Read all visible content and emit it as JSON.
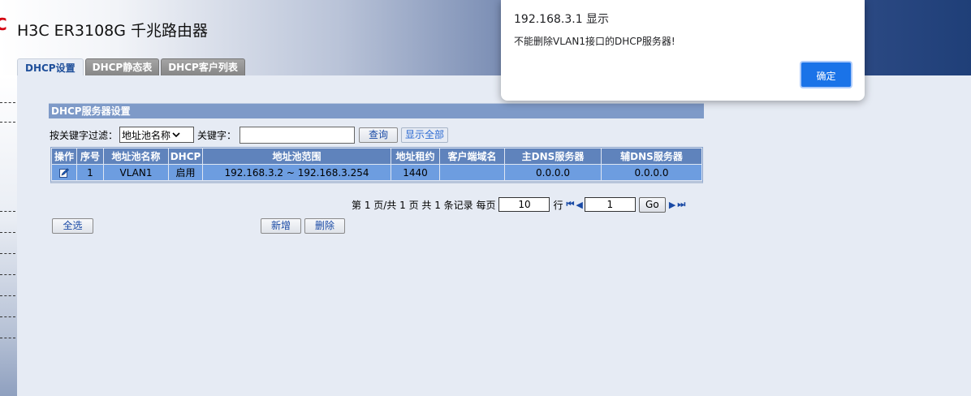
{
  "header": {
    "logo_text": "C",
    "product_title": "H3C ER3108G 千兆路由器"
  },
  "tabs": [
    {
      "label": "DHCP设置",
      "active": true
    },
    {
      "label": "DHCP静态表",
      "active": false
    },
    {
      "label": "DHCP客户列表",
      "active": false
    }
  ],
  "section": {
    "title": "DHCP服务器设置"
  },
  "filter": {
    "label": "按关键字过滤：",
    "selected_option": "地址池名称",
    "keyword_label": "关键字：",
    "keyword_value": "",
    "query_label": "查询",
    "show_all_label": "显示全部"
  },
  "table": {
    "headers": [
      "操作",
      "序号",
      "地址池名称",
      "DHCP",
      "地址池范围",
      "地址租约",
      "客户端域名",
      "主DNS服务器",
      "辅DNS服务器"
    ],
    "rows": [
      {
        "index": "1",
        "pool_name": "VLAN1",
        "dhcp": "启用",
        "range": "192.168.3.2 ~ 192.168.3.254",
        "lease": "1440",
        "domain": "",
        "dns1": "0.0.0.0",
        "dns2": "0.0.0.0"
      }
    ]
  },
  "pager": {
    "summary": "第 1 页/共 1 页 共 1 条记录 每页",
    "per_page": "10",
    "rows_unit": "行",
    "page": "1",
    "go_label": "Go"
  },
  "actions": {
    "select_all_label": "全选",
    "add_label": "新增",
    "delete_label": "删除"
  },
  "dialog": {
    "title": "192.168.3.1 显示",
    "message": "不能删除VLAN1接口的DHCP服务器!",
    "ok_label": "确定"
  },
  "colors": {
    "accent": "#1a73e8",
    "table_header": "#5f83bc",
    "table_row": "#6d9de0",
    "section_bar": "#7e9ac8",
    "logo": "#d40010"
  }
}
